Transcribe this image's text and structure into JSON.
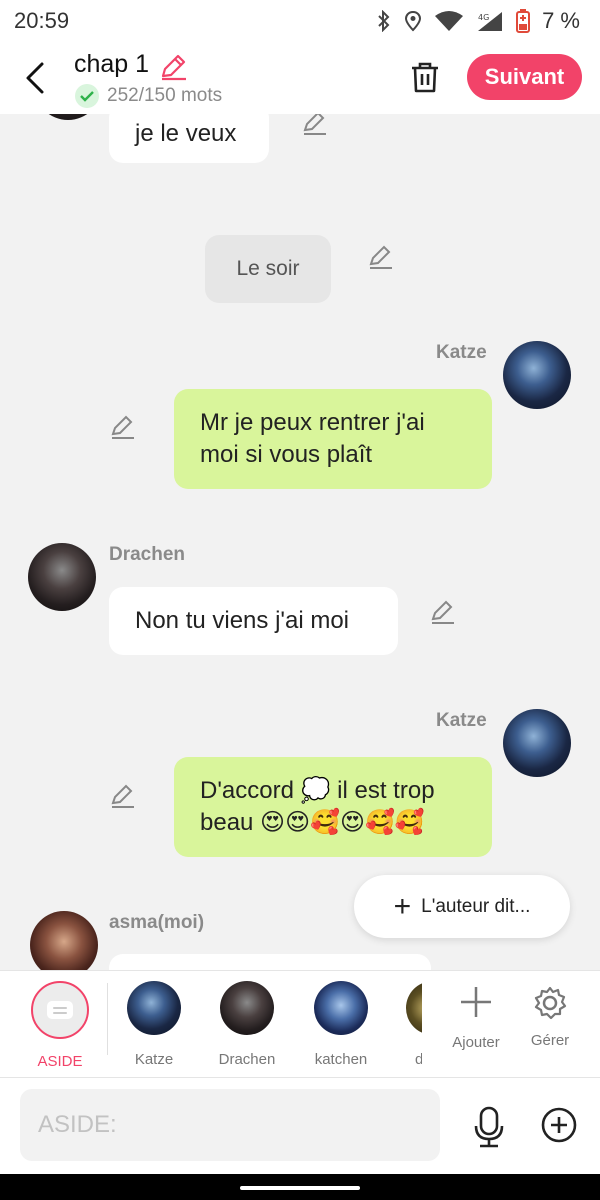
{
  "status": {
    "time": "20:59",
    "battery": "7 %"
  },
  "header": {
    "title": "chap 1",
    "word_count": "252/150 mots",
    "next_label": "Suivant"
  },
  "messages": [
    {
      "text": "je le veux"
    },
    {
      "text": "Le soir"
    },
    {
      "sender": "Katze",
      "lines": [
        "Mr je peux rentrer j'ai",
        "moi si vous plaît"
      ]
    },
    {
      "sender": "Drachen",
      "text": "Non tu viens j'ai moi"
    },
    {
      "sender": "Katze",
      "lines": [
        "D'accord 💭 il est trop",
        "beau 😍😍🥰😍🥰🥰"
      ]
    },
    {
      "sender": "asma(moi)"
    }
  ],
  "author_button": "L'auteur dit...",
  "characters": [
    {
      "label": "ASIDE"
    },
    {
      "label": "Katze"
    },
    {
      "label": "Drachen"
    },
    {
      "label": "katchen"
    },
    {
      "label": "d"
    }
  ],
  "tools": {
    "add_label": "Ajouter",
    "manage_label": "Gérer"
  },
  "input": {
    "placeholder": "ASIDE:"
  },
  "colors": {
    "accent": "#f24369",
    "green_bubble": "#d9f59b",
    "background": "#f2f2f2"
  }
}
